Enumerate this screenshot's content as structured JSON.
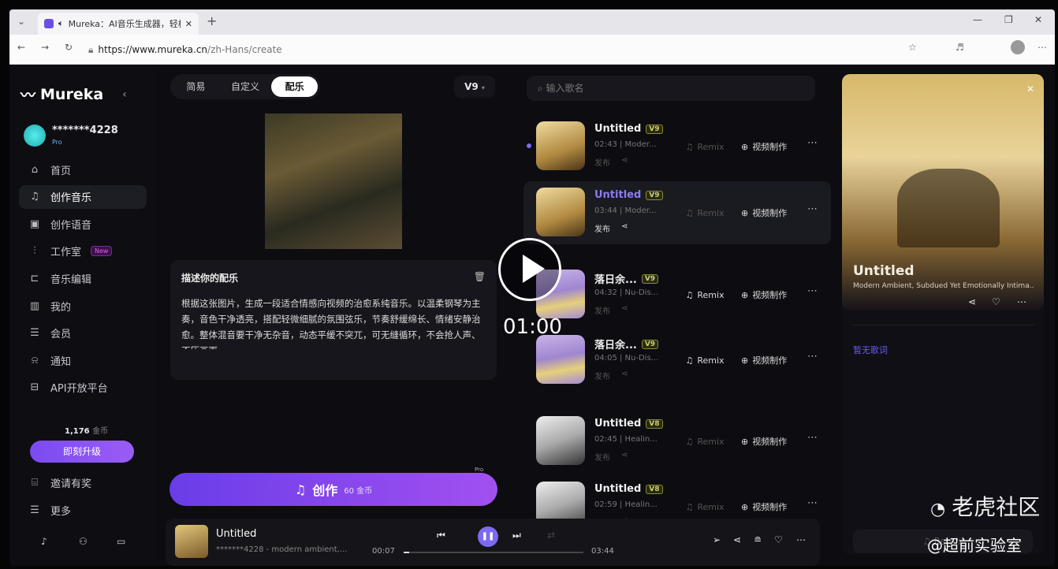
{
  "browser": {
    "tab_title": "Mureka：AI音乐生成器，轻松...",
    "url_host": "https://www.mureka.cn",
    "url_path": "/zh-Hans/create"
  },
  "sidebar": {
    "logo": "Mureka",
    "user": "*******4228",
    "plan": "Pro",
    "items": [
      {
        "label": "首页",
        "icon": "⌂"
      },
      {
        "label": "创作音乐",
        "icon": "♫"
      },
      {
        "label": "创作语音",
        "icon": "▣"
      },
      {
        "label": "工作室",
        "icon": "⫶",
        "badge": "New"
      },
      {
        "label": "音乐编辑",
        "icon": "⊏"
      },
      {
        "label": "我的",
        "icon": "▥"
      },
      {
        "label": "会员",
        "icon": "☰"
      },
      {
        "label": "通知",
        "icon": "⍾"
      },
      {
        "label": "API开放平台",
        "icon": "⊟"
      }
    ],
    "credits": "1,176",
    "credits_unit": "金币",
    "upgrade": "即刻升级",
    "invite": "邀请有奖",
    "more": "更多"
  },
  "create": {
    "tabs": [
      "简易",
      "自定义",
      "配乐"
    ],
    "active_tab": "配乐",
    "version": "V9",
    "desc_title": "描述你的配乐",
    "desc_text": "根据这张图片，生成一段适合情感向视频的治愈系纯音乐。以温柔钢琴为主奏，音色干净透亮，搭配轻微细腻的氛围弦乐，节奏舒缓绵长、情绪安静治愈。整体混音要干净无杂音，动态平缓不突兀，可无缝循环，不会抢人声、不压画面。",
    "button": "创作",
    "cost": "60 金币",
    "pro_tag": "Pro"
  },
  "list": {
    "search_placeholder": "输入歌名",
    "remix": "Remix",
    "video": "视频制作",
    "publish": "发布",
    "songs": [
      {
        "title": "Untitled",
        "ver": "V9",
        "meta": "02:43 | Moder...",
        "remix_enabled": false,
        "theme": "gold"
      },
      {
        "title": "Untitled",
        "ver": "V9",
        "meta": "03:44 | Moder...",
        "remix_enabled": false,
        "theme": "gold",
        "playing": true
      },
      {
        "title": "落日余...",
        "ver": "V9",
        "meta": "04:32 | Nu-Dis...",
        "remix_enabled": true,
        "theme": "purple"
      },
      {
        "title": "落日余...",
        "ver": "V9",
        "meta": "04:05 | Nu-Dis...",
        "remix_enabled": true,
        "theme": "purple"
      },
      {
        "title": "Untitled",
        "ver": "V8",
        "meta": "02:45 | Healin...",
        "remix_enabled": false,
        "theme": "gray"
      },
      {
        "title": "Untitled",
        "ver": "V8",
        "meta": "02:59 | Healin...",
        "remix_enabled": false,
        "theme": "gray"
      }
    ]
  },
  "detail": {
    "title": "Untitled",
    "subtitle": "Modern Ambient, Subdued Yet Emotionally Intima...",
    "no_lyrics": "暂无歌词",
    "remix": "Remix"
  },
  "player": {
    "title": "Untitled",
    "subtitle": "*******4228 - modern ambient,...",
    "current": "00:07",
    "duration": "03:44",
    "progress": 0.03
  },
  "overlay": {
    "time": "01:00"
  },
  "watermark": {
    "main": "老虎社区",
    "sub": "@超前实验室"
  }
}
